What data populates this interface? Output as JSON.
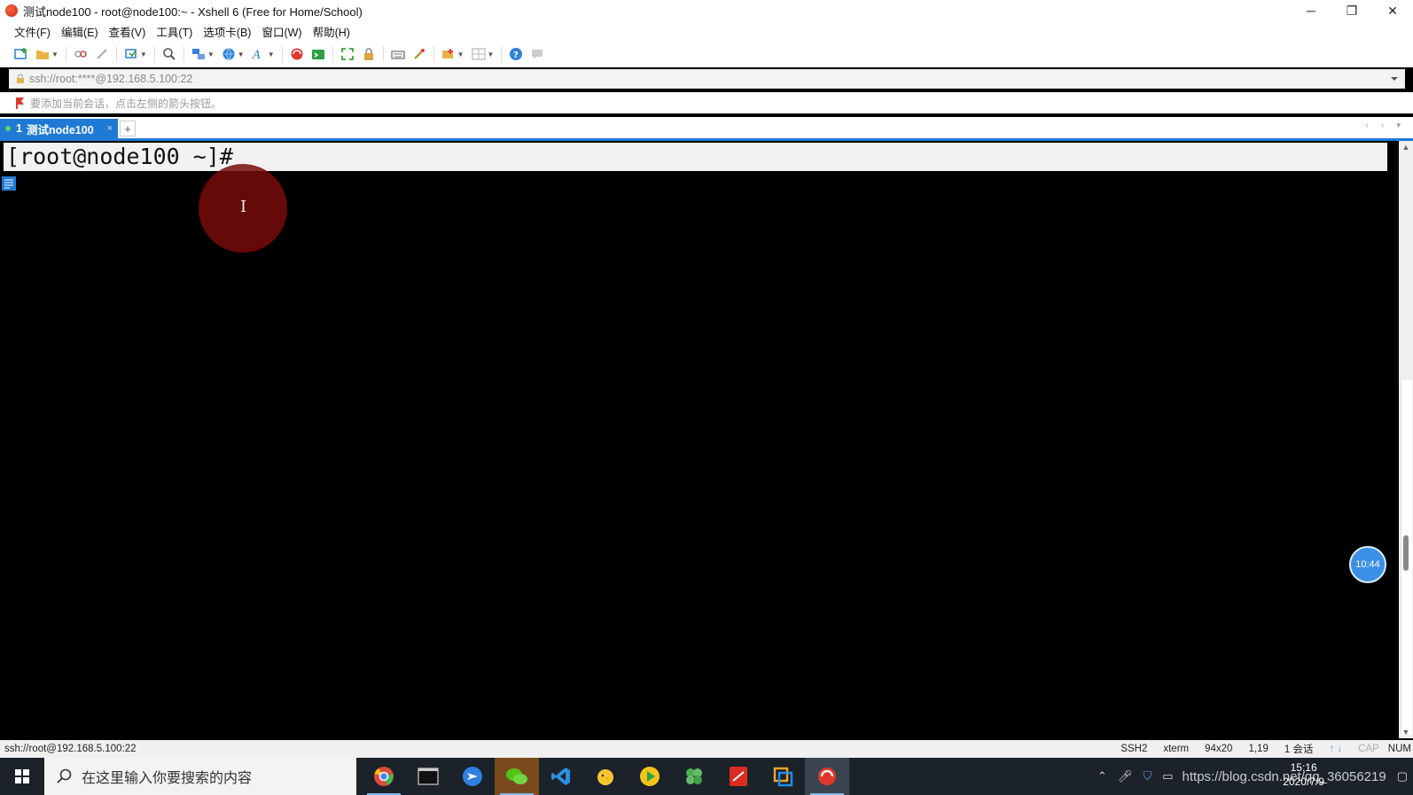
{
  "window": {
    "title": "测试node100 - root@node100:~ - Xshell 6 (Free for Home/School)",
    "controls": {
      "minimize": "─",
      "restore": "❐",
      "close": "✕"
    }
  },
  "menu": [
    "文件(F)",
    "编辑(E)",
    "查看(V)",
    "工具(T)",
    "选项卡(B)",
    "窗口(W)",
    "帮助(H)"
  ],
  "address": {
    "text": "ssh://root:****@192.168.5.100:22"
  },
  "hint": {
    "text": "要添加当前会话，点击左侧的箭头按钮。"
  },
  "tabs": [
    {
      "number": "1",
      "label": "测试node100",
      "close": "×"
    }
  ],
  "tab_add": "+",
  "tab_nav": "‹ › ▾",
  "terminal": {
    "prompt": "[root@node100 ~]#"
  },
  "timer": "10:44",
  "statusbar": {
    "connection": "ssh://root@192.168.5.100:22",
    "protocol": "SSH2",
    "term": "xterm",
    "size": "94x20",
    "cursor": "1,19",
    "sessions": "1 会话",
    "cap": "CAP",
    "num": "NUM"
  },
  "taskbar": {
    "search_placeholder": "在这里输入你要搜索的内容",
    "url_overlay": "https://blog.csdn.net/qq_36056219",
    "time": "15:16",
    "date": "2020/7/9"
  },
  "colors": {
    "accent": "#1f7ad6",
    "terminal_bg": "#000000",
    "taskbar": "#1c2229"
  }
}
